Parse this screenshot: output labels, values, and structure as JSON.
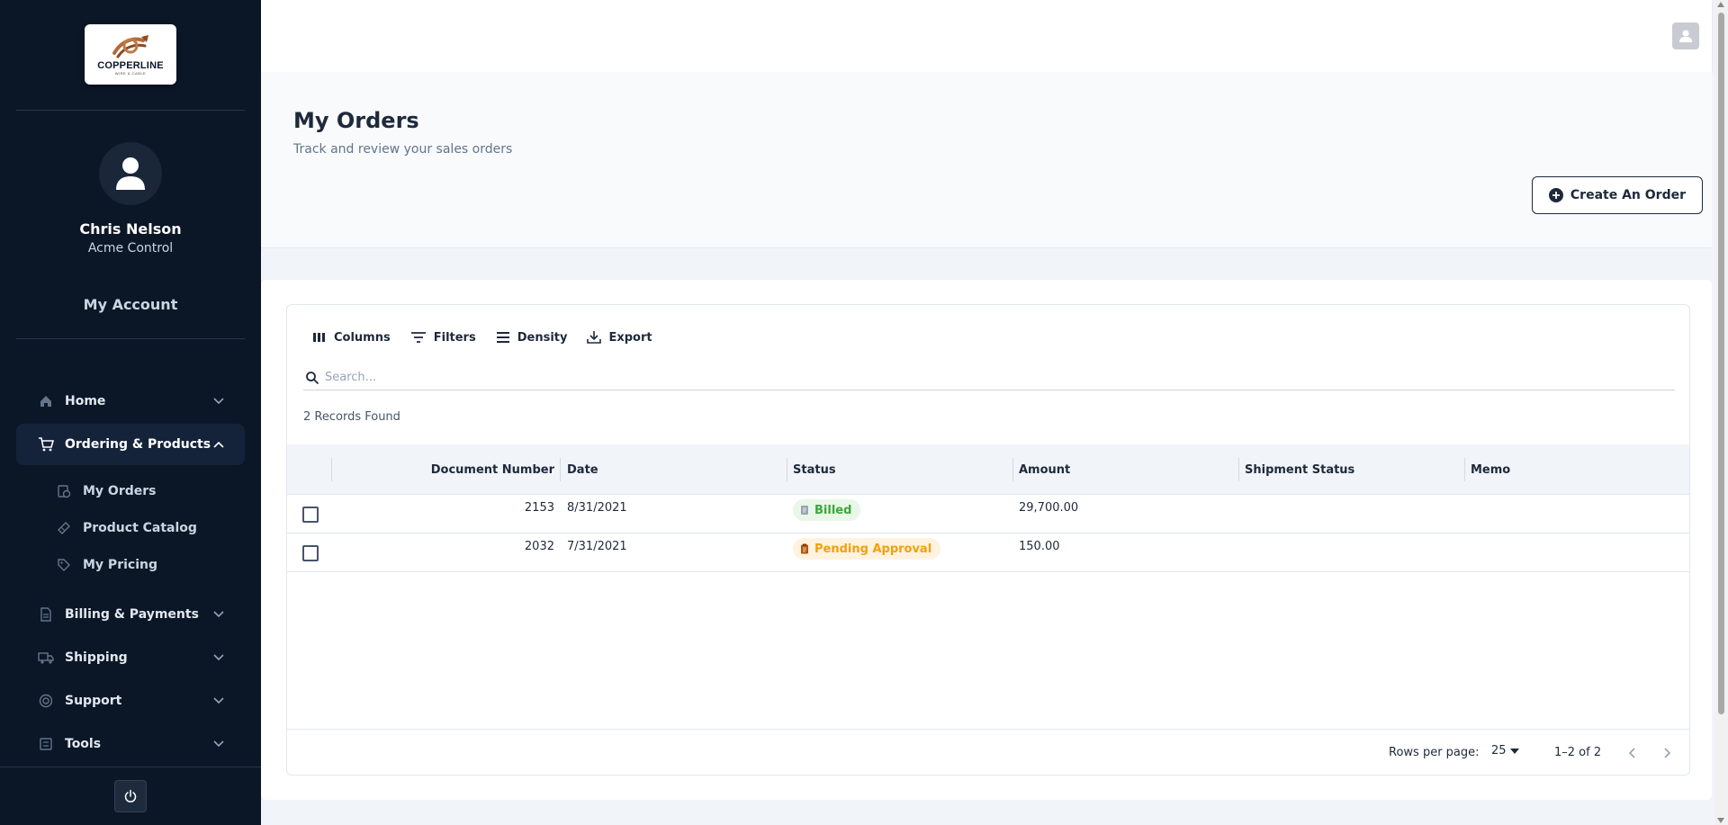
{
  "brand": {
    "logo_text": "COPPERLINE",
    "logo_subtext": "WIRE & CABLE"
  },
  "user": {
    "name": "Chris Nelson",
    "company": "Acme Control",
    "account_link": "My Account"
  },
  "nav": {
    "home": {
      "label": "Home",
      "icon": "home-icon"
    },
    "ordering": {
      "label": "Ordering & Products",
      "icon": "cart-icon",
      "items": [
        {
          "label": "My Orders",
          "icon": "orders-icon"
        },
        {
          "label": "Product Catalog",
          "icon": "catalog-icon"
        },
        {
          "label": "My Pricing",
          "icon": "tag-icon"
        }
      ]
    },
    "billing": {
      "label": "Billing & Payments",
      "icon": "invoice-icon"
    },
    "shipping": {
      "label": "Shipping",
      "icon": "truck-icon"
    },
    "support": {
      "label": "Support",
      "icon": "lifebuoy-icon"
    },
    "tools": {
      "label": "Tools",
      "icon": "tools-icon"
    }
  },
  "page": {
    "title": "My Orders",
    "subtitle": "Track and review your sales orders",
    "create_button": "Create An Order"
  },
  "toolbar": {
    "columns": "Columns",
    "filters": "Filters",
    "density": "Density",
    "export": "Export"
  },
  "search": {
    "placeholder": "Search..."
  },
  "records_found": "2 Records Found",
  "table": {
    "headers": [
      "Document Number",
      "Date",
      "Status",
      "Amount",
      "Shipment Status",
      "Memo"
    ],
    "rows": [
      {
        "document_number": "2153",
        "date": "8/31/2021",
        "status": "Billed",
        "status_type": "billed",
        "amount": "29,700.00",
        "shipment_status": "",
        "memo": ""
      },
      {
        "document_number": "2032",
        "date": "7/31/2021",
        "status": "Pending Approval",
        "status_type": "pending",
        "amount": "150.00",
        "shipment_status": "",
        "memo": ""
      }
    ]
  },
  "pagination": {
    "rows_per_page_label": "Rows per page:",
    "rows_per_page": "25",
    "range": "1–2 of 2"
  },
  "colors": {
    "sidebar_bg": "#0b1727",
    "billed": "#3ca63c",
    "pending": "#f59e0b",
    "accent": "#1e293b"
  }
}
